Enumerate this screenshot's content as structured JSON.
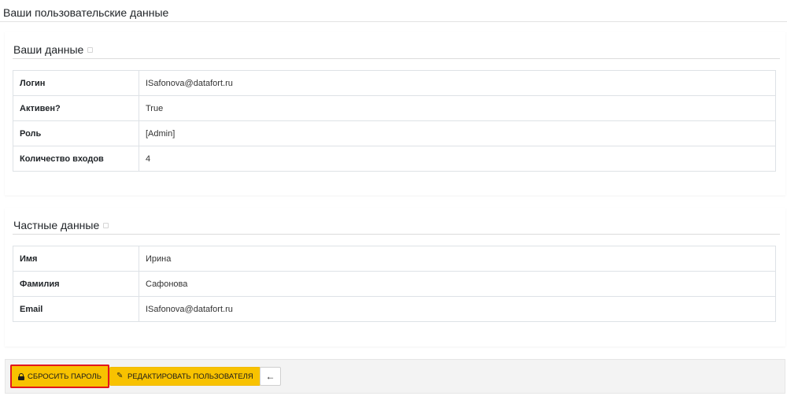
{
  "page": {
    "title": "Ваши пользовательские данные"
  },
  "account_section": {
    "title": "Ваши данные",
    "rows": [
      {
        "key": "Логин",
        "value": "ISafonova@datafort.ru"
      },
      {
        "key": "Активен?",
        "value": "True"
      },
      {
        "key": "Роль",
        "value": "[Admin]"
      },
      {
        "key": "Количество входов",
        "value": "4"
      }
    ]
  },
  "private_section": {
    "title": "Частные данные",
    "rows": [
      {
        "key": "Имя",
        "value": "Ирина"
      },
      {
        "key": "Фамилия",
        "value": "Сафонова"
      },
      {
        "key": "Email",
        "value": "ISafonova@datafort.ru"
      }
    ]
  },
  "toolbar": {
    "reset_password_label": "СБРОСИТЬ ПАРОЛЬ",
    "edit_user_label": "РЕДАКТИРОВАТЬ ПОЛЬЗОВАТЕЛЯ",
    "back_label": "←",
    "reset_icon": "lock-icon",
    "edit_icon": "edit-icon"
  },
  "colors": {
    "accent": "#f8c200",
    "highlight": "#e3171c"
  }
}
